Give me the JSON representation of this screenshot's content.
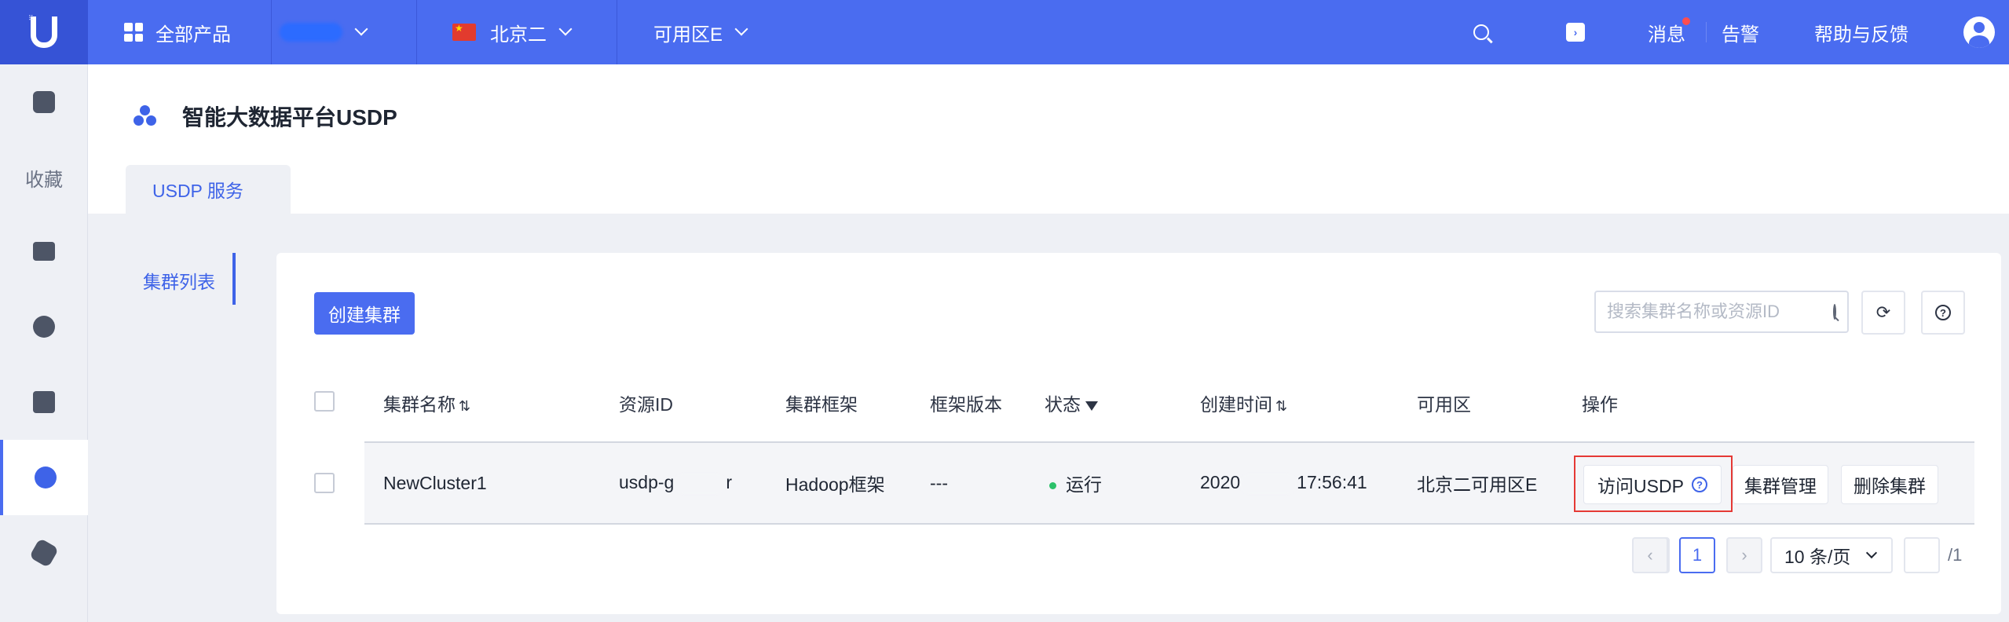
{
  "topbar": {
    "all_products": "全部产品",
    "region": "北京二",
    "zone": "可用区E",
    "messages": "消息",
    "alerts": "告警",
    "help": "帮助与反馈"
  },
  "sidebar": {
    "favorites": "收藏"
  },
  "header": {
    "title": "智能大数据平台USDP",
    "tab": "USDP 服务"
  },
  "subnav": {
    "item": "集群列表"
  },
  "toolbar": {
    "create_button": "创建集群",
    "search_placeholder": "搜索集群名称或资源ID",
    "refresh_icon": "⟳",
    "help_icon": "?"
  },
  "table": {
    "columns": [
      "集群名称",
      "资源ID",
      "集群框架",
      "框架版本",
      "状态",
      "创建时间",
      "可用区",
      "操作"
    ],
    "rows": [
      {
        "name": "NewCluster1",
        "resource_id_prefix": "usdp-g",
        "resource_id_suffix": "r",
        "framework": "Hadoop框架",
        "version": "---",
        "status": "运行",
        "created_prefix": "2020",
        "created_suffix": "17:56:41",
        "zone": "北京二可用区E",
        "actions": {
          "visit": "访问USDP",
          "manage": "集群管理",
          "delete": "删除集群"
        }
      }
    ]
  },
  "pagination": {
    "prev": "‹",
    "current": "1",
    "next": "›",
    "page_size": "10 条/页",
    "total": "/1"
  },
  "colors": {
    "brand": "#4a6cf0",
    "status_running": "#2cc16a",
    "highlight": "#e53935"
  }
}
